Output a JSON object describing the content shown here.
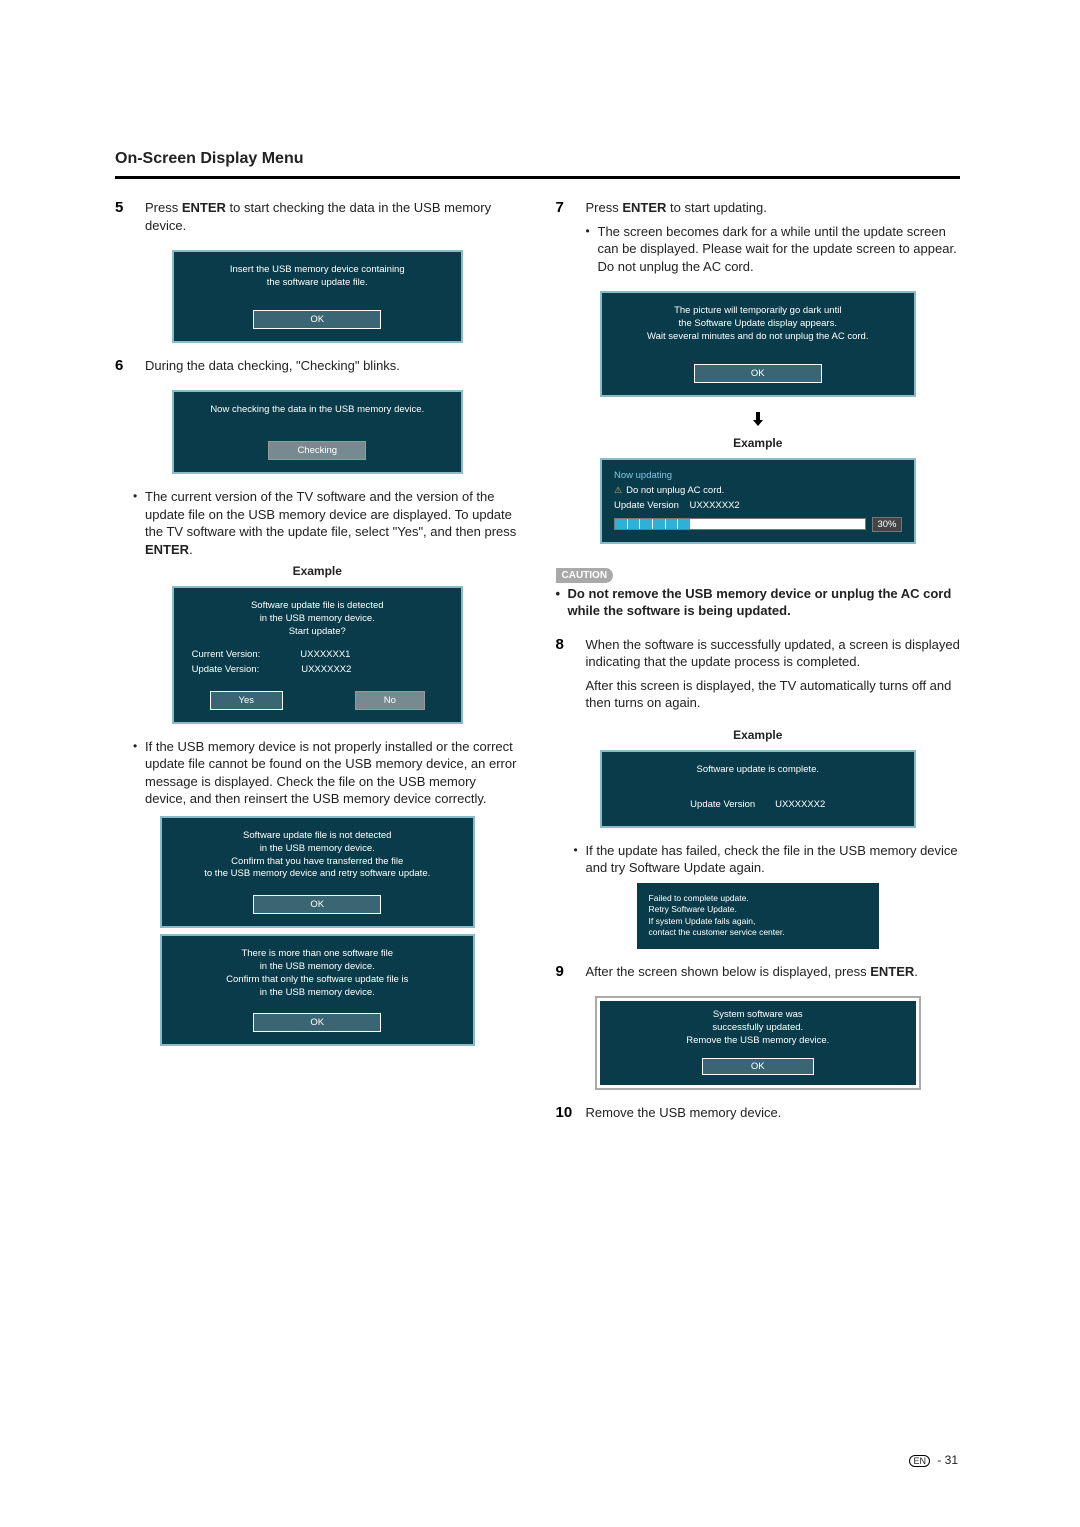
{
  "heading": "On-Screen Display Menu",
  "left": {
    "step5_num": "5",
    "step5_text_a": "Press ",
    "step5_enter": "ENTER",
    "step5_text_b": " to start checking the data in the USB memory device.",
    "panel5a_line1": "Insert the USB memory device containing",
    "panel5a_line2": "the software update file.",
    "ok": "OK",
    "step6_num": "6",
    "step6_text": "During the data checking, \"Checking\" blinks.",
    "panel6a_msg": "Now checking the data in the USB memory device.",
    "checking": "Checking",
    "step6_bullet_a": "The current version of the TV software and the version of the update file on the USB memory device are displayed. To update the TV software with the update file, select \"Yes\", and then press ",
    "step6_bullet_enter": "ENTER",
    "step6_bullet_b": ".",
    "example": "Example",
    "panel6b_l1": "Software update file is detected",
    "panel6b_l2": "in the USB memory device.",
    "panel6b_l3": "Start update?",
    "row_cv": "Current Version:",
    "row_uv": "Update Version:",
    "ver1": "UXXXXXX1",
    "ver2": "UXXXXXX2",
    "yes": "Yes",
    "no": "No",
    "step6_bullet2": "If the USB memory device is not properly installed or the correct update file cannot be found on the USB memory device, an error message is displayed. Check the file on the USB memory device, and then reinsert the USB memory device correctly.",
    "panel6c_l1": "Software update file is not detected",
    "panel6c_l2": "in the USB memory device.",
    "panel6c_l3": "Confirm that you have transferred the file",
    "panel6c_l4": "to the USB memory device and retry software update.",
    "panel6d_l1": "There is more than one software file",
    "panel6d_l2": "in the USB memory device.",
    "panel6d_l3": "Confirm that only the software update file is",
    "panel6d_l4": "in the USB memory device."
  },
  "right": {
    "step7_num": "7",
    "step7_text_a": "Press ",
    "step7_enter": "ENTER",
    "step7_text_b": " to start updating.",
    "step7_bullet": "The screen becomes dark for a while until the update screen can be displayed. Please wait for the update screen to appear. Do not unplug the AC cord.",
    "panel7a_l1": "The picture will temporarily go dark until",
    "panel7a_l2": "the Software Update display appears.",
    "panel7a_l3": "Wait several minutes and do not unplug the AC cord.",
    "ok": "OK",
    "example": "Example",
    "panel7b_now": "Now updating",
    "panel7b_warn": "Do not unplug AC cord.",
    "panel7b_uv": "Update Version",
    "panel7b_ver": "UXXXXXX2",
    "pct": "30%",
    "caution_tag": "CAUTION",
    "caution_text": "Do not remove the USB memory device or unplug the AC cord while the software is being updated.",
    "step8_num": "8",
    "step8_text": "When the software is successfully updated, a screen is displayed indicating that the update process is completed.",
    "step8_text2": "After this screen is displayed, the TV automatically turns off and then turns on again.",
    "panel8a_msg": "Software update is complete.",
    "panel8a_uv": "Update Version",
    "panel8a_ver": "UXXXXXX2",
    "step8_bullet": "If the update has failed, check the file in the USB memory device and try Software Update again.",
    "panel8b_l1": "Failed to complete update.",
    "panel8b_l2": "Retry Software Update.",
    "panel8b_l3": "If system Update fails again,",
    "panel8b_l4": "contact the customer service center.",
    "step9_num": "9",
    "step9_text_a": "After the screen shown below is displayed, press ",
    "step9_enter": "ENTER",
    "step9_text_b": ".",
    "panel9_l1": "System software was",
    "panel9_l2": "successfully updated.",
    "panel9_l3": "Remove the USB memory device.",
    "step10_num": "10",
    "step10_text": "Remove the USB memory device."
  },
  "footer": {
    "en": "EN",
    "sep": " - ",
    "page": "31"
  }
}
